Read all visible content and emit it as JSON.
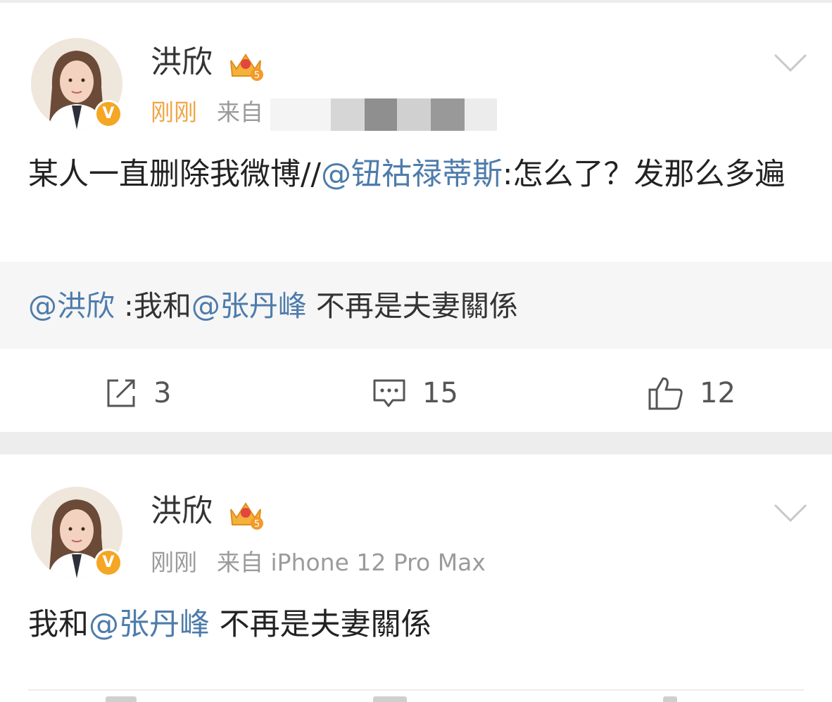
{
  "feed": {
    "posts": [
      {
        "username": "洪欣",
        "time": "刚刚",
        "source_label": "来自",
        "verified_badge": "V",
        "level_badge": "5",
        "text": [
          {
            "t": "某人一直删除我微博//",
            "mention": false
          },
          {
            "t": "@钮祜禄蒂斯",
            "mention": true
          },
          {
            "t": ":怎么了？发那么多遍",
            "mention": false
          }
        ],
        "repost": {
          "author": "@洪欣",
          "sep": " :",
          "pre": "我和",
          "mention": "@张丹峰",
          "post": " 不再是夫妻關係"
        },
        "actions": {
          "share_count": "3",
          "comment_count": "15",
          "like_count": "12"
        }
      },
      {
        "username": "洪欣",
        "time": "刚刚",
        "source_label": "来自",
        "source": "iPhone 12 Pro Max",
        "verified_badge": "V",
        "level_badge": "5",
        "text": [
          {
            "t": "我和",
            "mention": false
          },
          {
            "t": "@张丹峰",
            "mention": true
          },
          {
            "t": " 不再是夫妻關係",
            "mention": false
          }
        ]
      }
    ]
  },
  "colors": {
    "mention": "#4e7cab",
    "time_highlight": "#f0a545",
    "verified": "#f5a623",
    "meta": "#9b9b9b",
    "repost_bg": "#f6f6f6",
    "separator": "#ededed"
  },
  "icons": [
    "chevron-down-icon",
    "crown-level-icon",
    "verified-icon",
    "share-icon",
    "comment-icon",
    "like-icon"
  ]
}
